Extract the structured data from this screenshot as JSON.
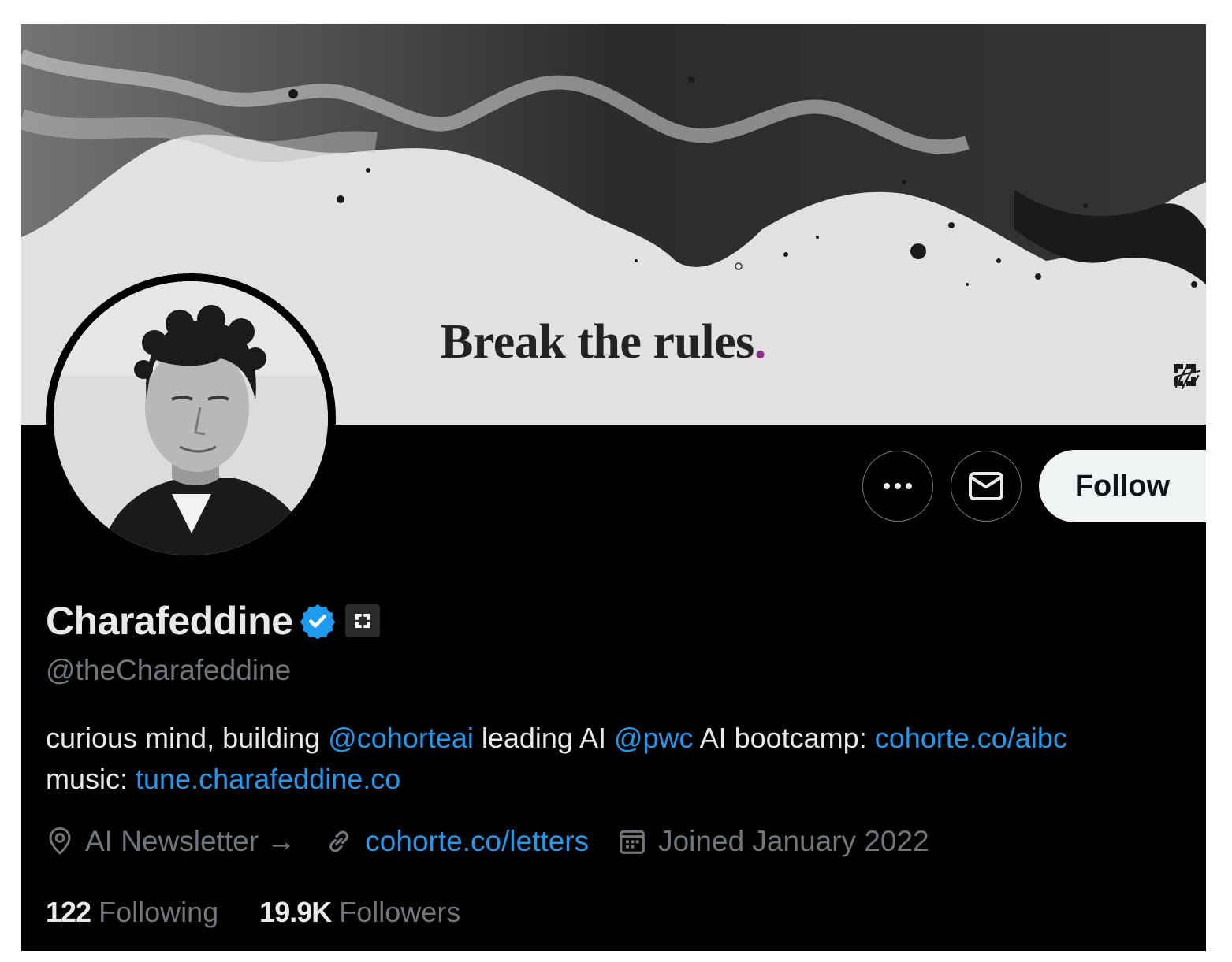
{
  "banner": {
    "tagline": "Break the rules",
    "tagline_dot": ".",
    "dot_color": "#8b2f8c",
    "logos": [
      "cohorte-logo-icon",
      "signature-icon"
    ]
  },
  "profile": {
    "avatar": "avatar",
    "display_name": "Charafeddine",
    "verified_icon": "verified-badge-icon",
    "affiliate_icon": "cohorte-affiliate-icon",
    "handle": "@theCharafeddine"
  },
  "actions": {
    "more_icon": "more-icon",
    "message_icon": "mail-icon",
    "follow_label": "Follow"
  },
  "bio": {
    "part1": "curious mind, building ",
    "mention1": "@cohorteai",
    "part2": " leading AI ",
    "mention2": "@pwc",
    "part3": " AI bootcamp: ",
    "link1": "cohorte.co/aibc",
    "part4": "music: ",
    "link2": "tune.charafeddine.co"
  },
  "meta": {
    "location": "AI Newsletter →",
    "website": "cohorte.co/letters",
    "joined": "Joined January 2022"
  },
  "stats": {
    "following_count": "122",
    "following_label": "Following",
    "followers_count": "19.9K",
    "followers_label": "Followers"
  },
  "colors": {
    "accent": "#1d9bf0",
    "background": "#000000",
    "muted": "#71767b",
    "text": "#e7e9ea"
  }
}
